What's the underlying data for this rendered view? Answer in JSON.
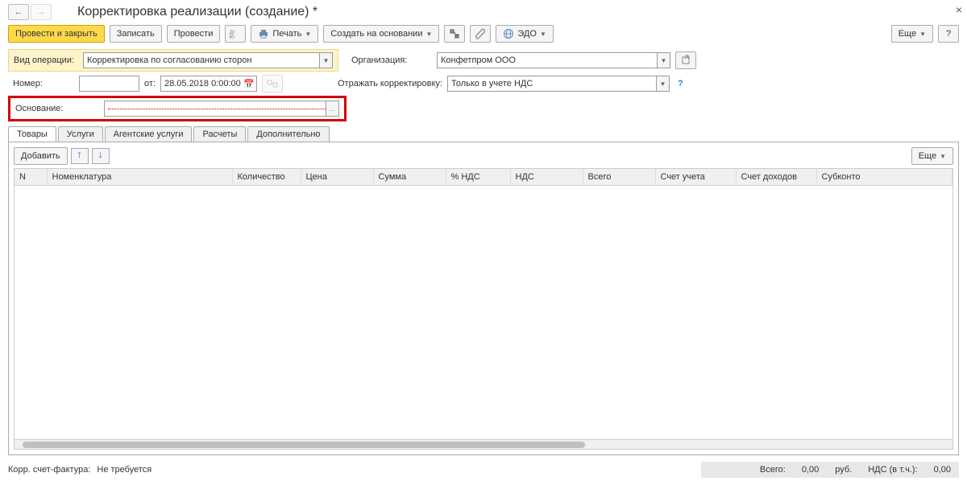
{
  "titlebar": {
    "title": "Корректировка реализации (создание) *"
  },
  "toolbar": {
    "post_close": "Провести и закрыть",
    "write": "Записать",
    "post": "Провести",
    "print": "Печать",
    "create_based": "Создать на основании",
    "edo": "ЭДО",
    "more": "Еще"
  },
  "fields": {
    "operation_type_label": "Вид операции:",
    "operation_type_value": "Корректировка по согласованию сторон",
    "org_label": "Организация:",
    "org_value": "Конфетпром ООО",
    "number_label": "Номер:",
    "from_label": "от:",
    "date_value": "28.05.2018  0:00:00",
    "reflect_label": "Отражать корректировку:",
    "reflect_value": "Только в учете НДС",
    "basis_label": "Основание:"
  },
  "tabs": [
    "Товары",
    "Услуги",
    "Агентские услуги",
    "Расчеты",
    "Дополнительно"
  ],
  "tab_toolbar": {
    "add": "Добавить",
    "more": "Еще"
  },
  "columns": [
    "N",
    "Номенклатура",
    "Количество",
    "Цена",
    "Сумма",
    "% НДС",
    "НДС",
    "Всего",
    "Счет учета",
    "Счет доходов",
    "Субконто"
  ],
  "footer": {
    "corr_invoice_label": "Корр. счет-фактура:",
    "corr_invoice_value": "Не требуется",
    "total_label": "Всего:",
    "total_value": "0,00",
    "currency": "руб.",
    "vat_label": "НДС (в т.ч.):",
    "vat_value": "0,00"
  }
}
